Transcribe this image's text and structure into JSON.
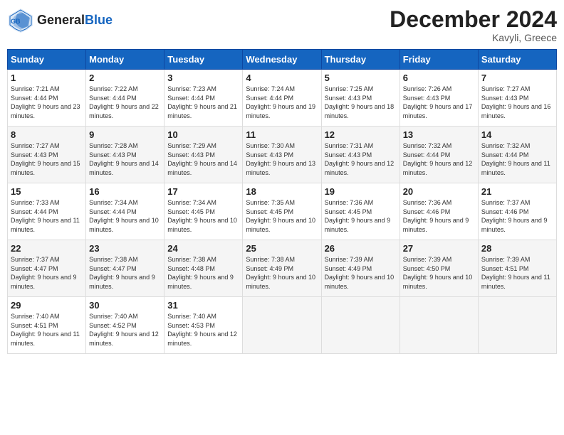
{
  "header": {
    "logo_general": "General",
    "logo_blue": "Blue",
    "month_title": "December 2024",
    "location": "Kavyli, Greece"
  },
  "columns": [
    "Sunday",
    "Monday",
    "Tuesday",
    "Wednesday",
    "Thursday",
    "Friday",
    "Saturday"
  ],
  "weeks": [
    [
      {
        "day": "1",
        "sunrise": "Sunrise: 7:21 AM",
        "sunset": "Sunset: 4:44 PM",
        "daylight": "Daylight: 9 hours and 23 minutes."
      },
      {
        "day": "2",
        "sunrise": "Sunrise: 7:22 AM",
        "sunset": "Sunset: 4:44 PM",
        "daylight": "Daylight: 9 hours and 22 minutes."
      },
      {
        "day": "3",
        "sunrise": "Sunrise: 7:23 AM",
        "sunset": "Sunset: 4:44 PM",
        "daylight": "Daylight: 9 hours and 21 minutes."
      },
      {
        "day": "4",
        "sunrise": "Sunrise: 7:24 AM",
        "sunset": "Sunset: 4:44 PM",
        "daylight": "Daylight: 9 hours and 19 minutes."
      },
      {
        "day": "5",
        "sunrise": "Sunrise: 7:25 AM",
        "sunset": "Sunset: 4:43 PM",
        "daylight": "Daylight: 9 hours and 18 minutes."
      },
      {
        "day": "6",
        "sunrise": "Sunrise: 7:26 AM",
        "sunset": "Sunset: 4:43 PM",
        "daylight": "Daylight: 9 hours and 17 minutes."
      },
      {
        "day": "7",
        "sunrise": "Sunrise: 7:27 AM",
        "sunset": "Sunset: 4:43 PM",
        "daylight": "Daylight: 9 hours and 16 minutes."
      }
    ],
    [
      {
        "day": "8",
        "sunrise": "Sunrise: 7:27 AM",
        "sunset": "Sunset: 4:43 PM",
        "daylight": "Daylight: 9 hours and 15 minutes."
      },
      {
        "day": "9",
        "sunrise": "Sunrise: 7:28 AM",
        "sunset": "Sunset: 4:43 PM",
        "daylight": "Daylight: 9 hours and 14 minutes."
      },
      {
        "day": "10",
        "sunrise": "Sunrise: 7:29 AM",
        "sunset": "Sunset: 4:43 PM",
        "daylight": "Daylight: 9 hours and 14 minutes."
      },
      {
        "day": "11",
        "sunrise": "Sunrise: 7:30 AM",
        "sunset": "Sunset: 4:43 PM",
        "daylight": "Daylight: 9 hours and 13 minutes."
      },
      {
        "day": "12",
        "sunrise": "Sunrise: 7:31 AM",
        "sunset": "Sunset: 4:43 PM",
        "daylight": "Daylight: 9 hours and 12 minutes."
      },
      {
        "day": "13",
        "sunrise": "Sunrise: 7:32 AM",
        "sunset": "Sunset: 4:44 PM",
        "daylight": "Daylight: 9 hours and 12 minutes."
      },
      {
        "day": "14",
        "sunrise": "Sunrise: 7:32 AM",
        "sunset": "Sunset: 4:44 PM",
        "daylight": "Daylight: 9 hours and 11 minutes."
      }
    ],
    [
      {
        "day": "15",
        "sunrise": "Sunrise: 7:33 AM",
        "sunset": "Sunset: 4:44 PM",
        "daylight": "Daylight: 9 hours and 11 minutes."
      },
      {
        "day": "16",
        "sunrise": "Sunrise: 7:34 AM",
        "sunset": "Sunset: 4:44 PM",
        "daylight": "Daylight: 9 hours and 10 minutes."
      },
      {
        "day": "17",
        "sunrise": "Sunrise: 7:34 AM",
        "sunset": "Sunset: 4:45 PM",
        "daylight": "Daylight: 9 hours and 10 minutes."
      },
      {
        "day": "18",
        "sunrise": "Sunrise: 7:35 AM",
        "sunset": "Sunset: 4:45 PM",
        "daylight": "Daylight: 9 hours and 10 minutes."
      },
      {
        "day": "19",
        "sunrise": "Sunrise: 7:36 AM",
        "sunset": "Sunset: 4:45 PM",
        "daylight": "Daylight: 9 hours and 9 minutes."
      },
      {
        "day": "20",
        "sunrise": "Sunrise: 7:36 AM",
        "sunset": "Sunset: 4:46 PM",
        "daylight": "Daylight: 9 hours and 9 minutes."
      },
      {
        "day": "21",
        "sunrise": "Sunrise: 7:37 AM",
        "sunset": "Sunset: 4:46 PM",
        "daylight": "Daylight: 9 hours and 9 minutes."
      }
    ],
    [
      {
        "day": "22",
        "sunrise": "Sunrise: 7:37 AM",
        "sunset": "Sunset: 4:47 PM",
        "daylight": "Daylight: 9 hours and 9 minutes."
      },
      {
        "day": "23",
        "sunrise": "Sunrise: 7:38 AM",
        "sunset": "Sunset: 4:47 PM",
        "daylight": "Daylight: 9 hours and 9 minutes."
      },
      {
        "day": "24",
        "sunrise": "Sunrise: 7:38 AM",
        "sunset": "Sunset: 4:48 PM",
        "daylight": "Daylight: 9 hours and 9 minutes."
      },
      {
        "day": "25",
        "sunrise": "Sunrise: 7:38 AM",
        "sunset": "Sunset: 4:49 PM",
        "daylight": "Daylight: 9 hours and 10 minutes."
      },
      {
        "day": "26",
        "sunrise": "Sunrise: 7:39 AM",
        "sunset": "Sunset: 4:49 PM",
        "daylight": "Daylight: 9 hours and 10 minutes."
      },
      {
        "day": "27",
        "sunrise": "Sunrise: 7:39 AM",
        "sunset": "Sunset: 4:50 PM",
        "daylight": "Daylight: 9 hours and 10 minutes."
      },
      {
        "day": "28",
        "sunrise": "Sunrise: 7:39 AM",
        "sunset": "Sunset: 4:51 PM",
        "daylight": "Daylight: 9 hours and 11 minutes."
      }
    ],
    [
      {
        "day": "29",
        "sunrise": "Sunrise: 7:40 AM",
        "sunset": "Sunset: 4:51 PM",
        "daylight": "Daylight: 9 hours and 11 minutes."
      },
      {
        "day": "30",
        "sunrise": "Sunrise: 7:40 AM",
        "sunset": "Sunset: 4:52 PM",
        "daylight": "Daylight: 9 hours and 12 minutes."
      },
      {
        "day": "31",
        "sunrise": "Sunrise: 7:40 AM",
        "sunset": "Sunset: 4:53 PM",
        "daylight": "Daylight: 9 hours and 12 minutes."
      },
      null,
      null,
      null,
      null
    ]
  ]
}
